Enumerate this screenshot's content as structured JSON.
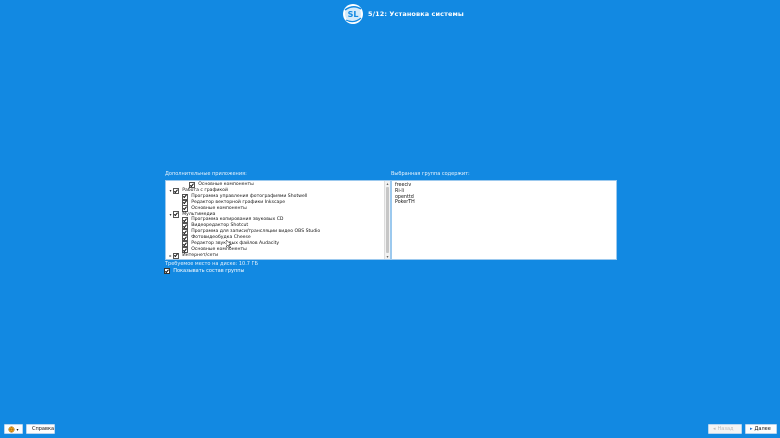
{
  "header": {
    "logo_text": "SL",
    "title": "5/12: Установка системы"
  },
  "apps": {
    "label": "Дополнительные приложения:",
    "rows": [
      {
        "level": 2,
        "expander": "",
        "checked": true,
        "label": "Основные компоненты"
      },
      {
        "level": 0,
        "expander": "▾",
        "checked": true,
        "label": "Работа с графикой"
      },
      {
        "level": 1,
        "expander": "",
        "checked": true,
        "label": "Программа управления фотографиями Shotwell"
      },
      {
        "level": 1,
        "expander": "",
        "checked": true,
        "label": "Редактор векторной графики Inkscape"
      },
      {
        "level": 1,
        "expander": "",
        "checked": true,
        "label": "Основные компоненты"
      },
      {
        "level": 0,
        "expander": "▾",
        "checked": true,
        "label": "Мультимедиа"
      },
      {
        "level": 1,
        "expander": "",
        "checked": true,
        "label": "Программа копирования звуковых CD"
      },
      {
        "level": 1,
        "expander": "",
        "checked": true,
        "label": "Видеоредактор Shotcut"
      },
      {
        "level": 1,
        "expander": "",
        "checked": true,
        "label": "Программа для записи/трансляции видео OBS Studio"
      },
      {
        "level": 1,
        "expander": "",
        "checked": true,
        "label": "Фотовидеобудка Cheese"
      },
      {
        "level": 1,
        "expander": "",
        "checked": true,
        "label": "Редактор звуковых файлов Audacity"
      },
      {
        "level": 1,
        "expander": "",
        "checked": true,
        "label": "Основные компоненты"
      },
      {
        "level": 0,
        "expander": "▸",
        "checked": true,
        "label": "Интернет/сети"
      }
    ]
  },
  "groups": {
    "label": "Выбранная группа содержит:",
    "items": [
      "freeciv",
      "Ri-li",
      "openttd",
      "PokerTH"
    ]
  },
  "disk_space": "Требуемое место на диске: 10.7 ГБ",
  "show_state": {
    "label": "Показывать состав группы",
    "checked": true
  },
  "footer": {
    "lang_icon": "globe-icon",
    "help_label": "Справка",
    "back_label": "Назад",
    "next_label": "Далее"
  },
  "colors": {
    "background": "#1289e2",
    "panel": "#ffffff"
  }
}
